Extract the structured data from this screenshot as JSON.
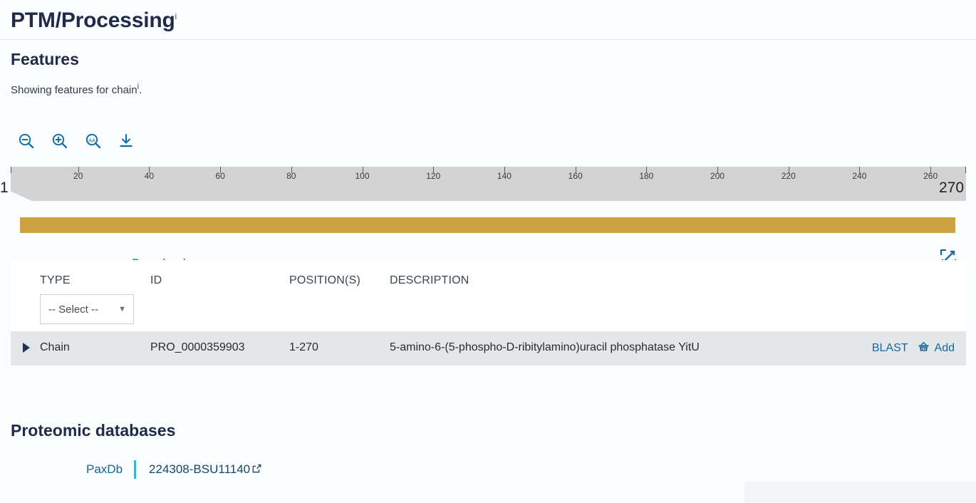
{
  "section": {
    "title": "PTM/Processing",
    "info_marker": "i"
  },
  "features": {
    "heading": "Features",
    "subtitle_text": "Showing features for chain",
    "subtitle_info": "i",
    "subtitle_end": "."
  },
  "toolbar": {
    "zoom_out_icon": "zoom-out-icon",
    "zoom_in_icon": "zoom-in-icon",
    "zoom_aa_icon": "zoom-amino-acid-icon",
    "download_icon": "download-icon",
    "download_label": "Download",
    "fullscreen_icon": "fullscreen-expand-icon"
  },
  "ruler": {
    "start_label": "1",
    "end_label": "270",
    "ticks": [
      20,
      40,
      60,
      80,
      100,
      120,
      140,
      160,
      180,
      200,
      220,
      240,
      260
    ],
    "min": 1,
    "max": 270
  },
  "track": {
    "feature_color": "#cea242",
    "feature_start": 1,
    "feature_end": 270
  },
  "table": {
    "columns": [
      "TYPE",
      "ID",
      "POSITION(S)",
      "DESCRIPTION"
    ],
    "type_filter": {
      "value": "-- Select --",
      "caret": "▼"
    },
    "rows": [
      {
        "expander": "expand-arrow",
        "type": "Chain",
        "id": "PRO_0000359903",
        "positions": "1-270",
        "description": "5-amino-6-(5-phospho-D-ribitylamino)uracil phosphatase YitU",
        "blast_label": "BLAST",
        "add_label": "Add",
        "basket_icon": "basket-icon"
      }
    ]
  },
  "proteomic": {
    "heading": "Proteomic databases",
    "entries": [
      {
        "name": "PaxDb",
        "value": "224308-BSU11140",
        "external_icon": "external-link-icon"
      }
    ]
  },
  "colors": {
    "accent_link": "#16699e",
    "heading": "#1f2b49",
    "feature_bar": "#cea242",
    "row_bg": "#e4e7ea",
    "ruler_bg": "#d3d3d3",
    "divider": "#3ab3d6"
  }
}
